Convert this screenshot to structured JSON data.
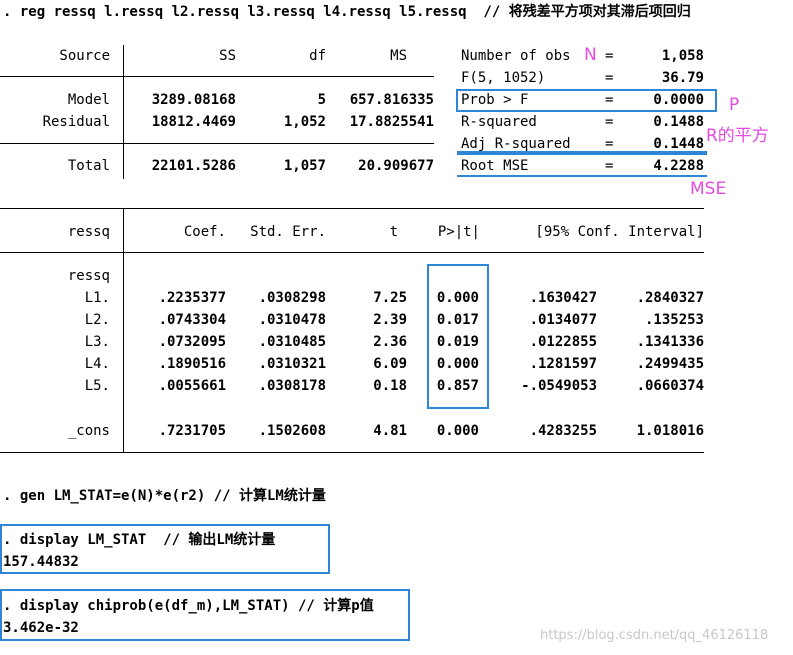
{
  "command1": ". reg ressq l.ressq l2.ressq l3.ressq l4.ressq l5.ressq  // 将残差平方项对其滞后项回归",
  "anova": {
    "header": {
      "source": "Source",
      "ss": "SS",
      "df": "df",
      "ms": "MS"
    },
    "rows": [
      {
        "source": "Model",
        "ss": "3289.08168",
        "df": "5",
        "ms": "657.816335"
      },
      {
        "source": "Residual",
        "ss": "18812.4469",
        "df": "1,052",
        "ms": "17.8825541"
      }
    ],
    "total": {
      "source": "Total",
      "ss": "22101.5286",
      "df": "1,057",
      "ms": "20.909677"
    }
  },
  "stats": [
    {
      "label": "Number of obs",
      "eq": "=",
      "value": "1,058"
    },
    {
      "label": "F(5, 1052)",
      "eq": "=",
      "value": "36.79"
    },
    {
      "label": "Prob > F",
      "eq": "=",
      "value": "0.0000"
    },
    {
      "label": "R-squared",
      "eq": "=",
      "value": "0.1488"
    },
    {
      "label": "Adj R-squared",
      "eq": "=",
      "value": "0.1448"
    },
    {
      "label": "Root MSE",
      "eq": "=",
      "value": "4.2288"
    }
  ],
  "annotations": {
    "n": "N",
    "p": "P",
    "r2": "R的平方",
    "mse": "MSE"
  },
  "coef": {
    "header": {
      "var": "ressq",
      "coef": "Coef.",
      "se": "Std. Err.",
      "t": "t",
      "p": "P>|t|",
      "ci": "[95% Conf. Interval]"
    },
    "group": "ressq",
    "rows": [
      {
        "var": "L1.",
        "coef": ".2235377",
        "se": ".0308298",
        "t": "7.25",
        "p": "0.000",
        "lo": ".1630427",
        "hi": ".2840327"
      },
      {
        "var": "L2.",
        "coef": ".0743304",
        "se": ".0310478",
        "t": "2.39",
        "p": "0.017",
        "lo": ".0134077",
        "hi": ".135253"
      },
      {
        "var": "L3.",
        "coef": ".0732095",
        "se": ".0310485",
        "t": "2.36",
        "p": "0.019",
        "lo": ".0122855",
        "hi": ".1341336"
      },
      {
        "var": "L4.",
        "coef": ".1890516",
        "se": ".0310321",
        "t": "6.09",
        "p": "0.000",
        "lo": ".1281597",
        "hi": ".2499435"
      },
      {
        "var": "L5.",
        "coef": ".0055661",
        "se": ".0308178",
        "t": "0.18",
        "p": "0.857",
        "lo": "-.0549053",
        "hi": ".0660374"
      }
    ],
    "cons": {
      "var": "_cons",
      "coef": ".7231705",
      "se": ".1502608",
      "t": "4.81",
      "p": "0.000",
      "lo": ".4283255",
      "hi": "1.018016"
    }
  },
  "command2": ". gen LM_STAT=e(N)*e(r2) // 计算LM统计量",
  "command3": ". display LM_STAT  // 输出LM统计量",
  "output3": "157.44832",
  "command4": ". display chiprob(e(df_m),LM_STAT) // 计算p值",
  "output4": "3.462e-32",
  "watermark": "https://blog.csdn.net/qq_46126118",
  "colors": {
    "highlight_box": "#2f86d6",
    "annotation": "#e64ae0"
  }
}
